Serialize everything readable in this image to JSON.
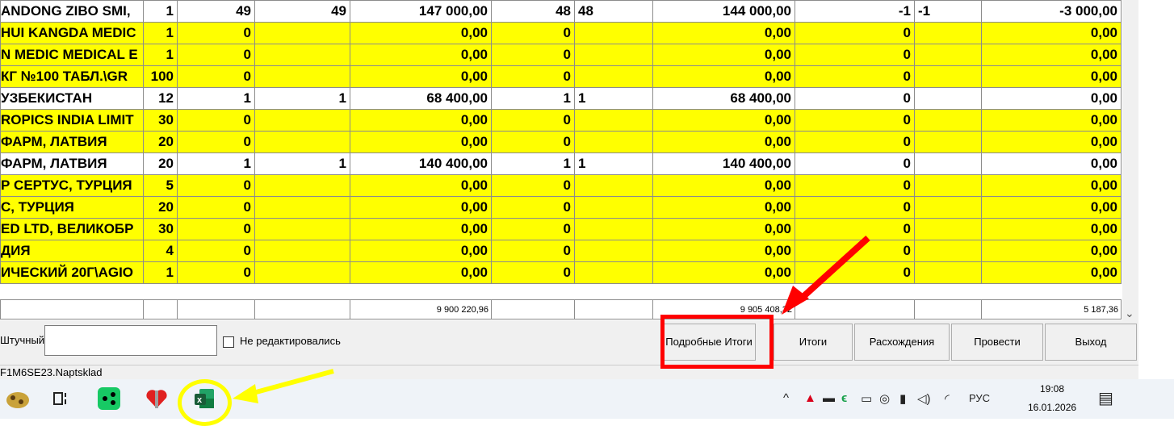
{
  "grid": {
    "rows": [
      {
        "name": "ANDONG ZIBO SMI,",
        "c1": "1",
        "c2": "49",
        "c3": "49",
        "c4": "147 000,00",
        "c5": "48",
        "c6": "48",
        "c7": "144 000,00",
        "c8": "-1",
        "c9": "-1",
        "c10": "-3 000,00",
        "highlight": false
      },
      {
        "name": "HUI KANGDA MEDIC",
        "c1": "1",
        "c2": "0",
        "c3": "",
        "c4": "0,00",
        "c5": "0",
        "c6": "",
        "c7": "0,00",
        "c8": "0",
        "c9": "",
        "c10": "0,00",
        "highlight": true
      },
      {
        "name": "N MEDIC MEDICAL E",
        "c1": "1",
        "c2": "0",
        "c3": "",
        "c4": "0,00",
        "c5": "0",
        "c6": "",
        "c7": "0,00",
        "c8": "0",
        "c9": "",
        "c10": "0,00",
        "highlight": true
      },
      {
        "name": "КГ №100 ТАБЛ.\\GR",
        "c1": "100",
        "c2": "0",
        "c3": "",
        "c4": "0,00",
        "c5": "0",
        "c6": "",
        "c7": "0,00",
        "c8": "0",
        "c9": "",
        "c10": "0,00",
        "highlight": true
      },
      {
        "name": "УЗБЕКИСТАН",
        "c1": "12",
        "c2": "1",
        "c3": "1",
        "c4": "68 400,00",
        "c5": "1",
        "c6": "1",
        "c7": "68 400,00",
        "c8": "0",
        "c9": "",
        "c10": "0,00",
        "highlight": false
      },
      {
        "name": "ROPICS INDIA LIMIT",
        "c1": "30",
        "c2": "0",
        "c3": "",
        "c4": "0,00",
        "c5": "0",
        "c6": "",
        "c7": "0,00",
        "c8": "0",
        "c9": "",
        "c10": "0,00",
        "highlight": true
      },
      {
        "name": "ФАРМ, ЛАТВИЯ",
        "c1": "20",
        "c2": "0",
        "c3": "",
        "c4": "0,00",
        "c5": "0",
        "c6": "",
        "c7": "0,00",
        "c8": "0",
        "c9": "",
        "c10": "0,00",
        "highlight": true
      },
      {
        "name": "ФАРМ, ЛАТВИЯ",
        "c1": "20",
        "c2": "1",
        "c3": "1",
        "c4": "140 400,00",
        "c5": "1",
        "c6": "1",
        "c7": "140 400,00",
        "c8": "0",
        "c9": "",
        "c10": "0,00",
        "highlight": false
      },
      {
        "name": "Р СЕРТУС, ТУРЦИЯ",
        "c1": "5",
        "c2": "0",
        "c3": "",
        "c4": "0,00",
        "c5": "0",
        "c6": "",
        "c7": "0,00",
        "c8": "0",
        "c9": "",
        "c10": "0,00",
        "highlight": true
      },
      {
        "name": "С, ТУРЦИЯ",
        "c1": "20",
        "c2": "0",
        "c3": "",
        "c4": "0,00",
        "c5": "0",
        "c6": "",
        "c7": "0,00",
        "c8": "0",
        "c9": "",
        "c10": "0,00",
        "highlight": true
      },
      {
        "name": "ED LTD, ВЕЛИКОБР",
        "c1": "30",
        "c2": "0",
        "c3": "",
        "c4": "0,00",
        "c5": "0",
        "c6": "",
        "c7": "0,00",
        "c8": "0",
        "c9": "",
        "c10": "0,00",
        "highlight": true
      },
      {
        "name": "ДИЯ",
        "c1": "4",
        "c2": "0",
        "c3": "",
        "c4": "0,00",
        "c5": "0",
        "c6": "",
        "c7": "0,00",
        "c8": "0",
        "c9": "",
        "c10": "0,00",
        "highlight": true
      },
      {
        "name": "ИЧЕСКИЙ 20Г\\AGIO",
        "c1": "1",
        "c2": "0",
        "c3": "",
        "c4": "0,00",
        "c5": "0",
        "c6": "",
        "c7": "0,00",
        "c8": "0",
        "c9": "",
        "c10": "0,00",
        "highlight": true
      }
    ]
  },
  "totals": {
    "sum_a": "9 900 220,96",
    "sum_b": "9 905 408,32",
    "sum_c": "5 187,36"
  },
  "bottom": {
    "piece_label": "Штучный",
    "not_edited_label": "Не редактировались",
    "buttons": {
      "details": "Подробные Итоги",
      "totals": "Итоги",
      "discrepancies": "Расхождения",
      "post": "Провести",
      "exit": "Выход"
    }
  },
  "status": {
    "text": "F1M6SE23.Naptsklad"
  },
  "taskbar": {
    "icons": [
      "app-logo-icon",
      "task-view-icon",
      "green-app-icon",
      "heart-app-icon",
      "excel-icon"
    ],
    "tray": {
      "language": "РУС",
      "time": "19:08",
      "date": "16.01.2026"
    }
  },
  "annotations": {
    "red_box_color": "#ff0000",
    "yellow_circle_color": "#ffff00"
  }
}
